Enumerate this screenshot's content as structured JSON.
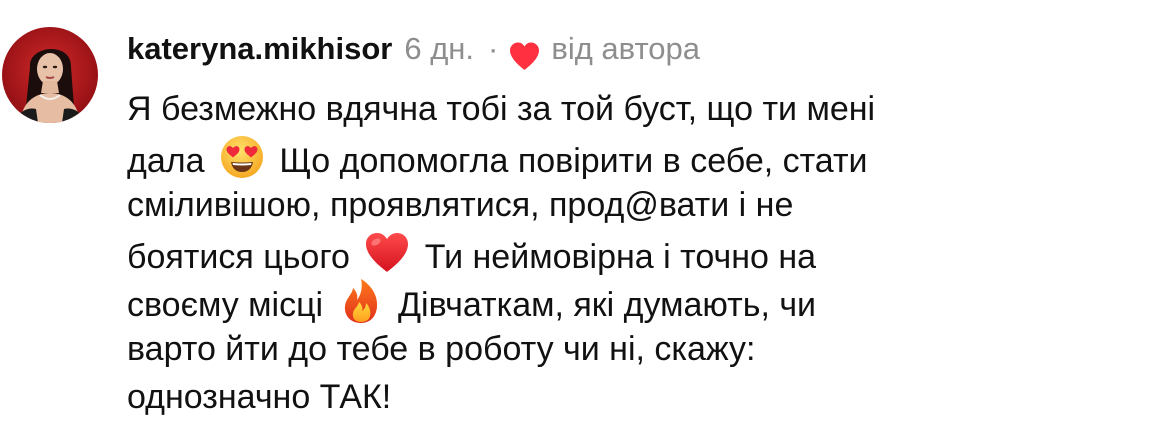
{
  "comment": {
    "username": "kateryna.mikhisor",
    "time": "6 дн.",
    "separator": "·",
    "liked_by_author": "від автора",
    "text_segments": {
      "s1": "Я безмежно вдячна тобі за той буст, що ти мені",
      "s2": "дала",
      "s3": "Що допомогла повірити в себе, стати",
      "s4": "сміливішою, проявлятися, прод@вати і не",
      "s5": "боятися цього",
      "s6": "Ти неймовірна і точно на",
      "s7": "своєму місці",
      "s8": "Дівчаткам, які думають, чи",
      "s9": "варто йти до тебе в роботу чи ні, скажу:",
      "s10": "однозначно ТАК!"
    },
    "emojis": [
      "smiling-face-with-heart-eyes",
      "red-heart",
      "fire"
    ]
  },
  "colors": {
    "text": "#111111",
    "muted": "#8e8e8e",
    "heart": "#ff3040"
  }
}
